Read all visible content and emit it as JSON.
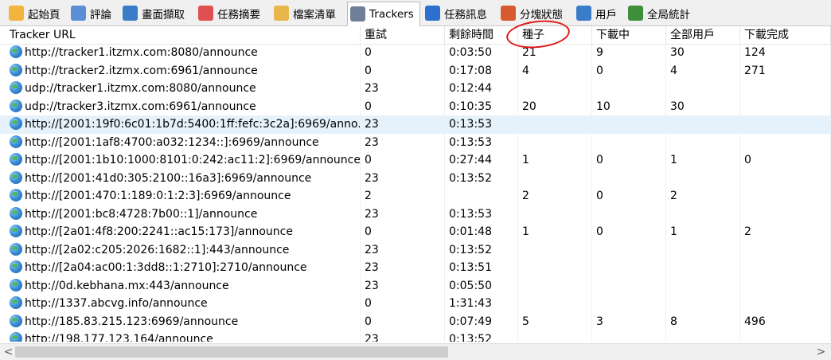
{
  "tabs": [
    {
      "label": "起始頁",
      "icon": "home-icon",
      "color": "#f3b43b"
    },
    {
      "label": "評論",
      "icon": "comment-icon",
      "color": "#5a8fd6"
    },
    {
      "label": "畫面擷取",
      "icon": "screenshot-icon",
      "color": "#3a7cc8"
    },
    {
      "label": "任務摘要",
      "icon": "checklist-icon",
      "color": "#e05050"
    },
    {
      "label": "檔案清單",
      "icon": "file-list-icon",
      "color": "#e8b64a"
    },
    {
      "label": "Trackers",
      "icon": "trackers-icon",
      "color": "#6f7f99"
    },
    {
      "label": "任務訊息",
      "icon": "info-icon",
      "color": "#2d6fcf"
    },
    {
      "label": "分塊狀態",
      "icon": "pie-chart-icon",
      "color": "#d65a2d"
    },
    {
      "label": "用戶",
      "icon": "user-icon",
      "color": "#3a7cc8"
    },
    {
      "label": "全局統計",
      "icon": "stats-icon",
      "color": "#3e8e3e"
    }
  ],
  "columns": {
    "url": "Tracker URL",
    "retry": "重試",
    "time": "剩餘時間",
    "seeds": "種子",
    "downloading": "下載中",
    "users": "全部用戶",
    "completed": "下載完成"
  },
  "rows": [
    {
      "url": "http://tracker1.itzmx.com:8080/announce",
      "retry": "0",
      "time": "0:03:50",
      "seeds": "21",
      "downloading": "9",
      "users": "30",
      "completed": "124"
    },
    {
      "url": "http://tracker2.itzmx.com:6961/announce",
      "retry": "0",
      "time": "0:17:08",
      "seeds": "4",
      "downloading": "0",
      "users": "4",
      "completed": "271"
    },
    {
      "url": "udp://tracker1.itzmx.com:8080/announce",
      "retry": "23",
      "time": "0:12:44",
      "seeds": "",
      "downloading": "",
      "users": "",
      "completed": ""
    },
    {
      "url": "udp://tracker3.itzmx.com:6961/announce",
      "retry": "0",
      "time": "0:10:35",
      "seeds": "20",
      "downloading": "10",
      "users": "30",
      "completed": ""
    },
    {
      "url": "http://[2001:19f0:6c01:1b7d:5400:1ff:fefc:3c2a]:6969/anno...",
      "retry": "23",
      "time": "0:13:53",
      "seeds": "",
      "downloading": "",
      "users": "",
      "completed": ""
    },
    {
      "url": "http://[2001:1af8:4700:a032:1234::]:6969/announce",
      "retry": "23",
      "time": "0:13:53",
      "seeds": "",
      "downloading": "",
      "users": "",
      "completed": ""
    },
    {
      "url": "http://[2001:1b10:1000:8101:0:242:ac11:2]:6969/announce",
      "retry": "0",
      "time": "0:27:44",
      "seeds": "1",
      "downloading": "0",
      "users": "1",
      "completed": "0"
    },
    {
      "url": "http://[2001:41d0:305:2100::16a3]:6969/announce",
      "retry": "23",
      "time": "0:13:52",
      "seeds": "",
      "downloading": "",
      "users": "",
      "completed": ""
    },
    {
      "url": "http://[2001:470:1:189:0:1:2:3]:6969/announce",
      "retry": "2",
      "time": "",
      "seeds": "2",
      "downloading": "0",
      "users": "2",
      "completed": ""
    },
    {
      "url": "http://[2001:bc8:4728:7b00::1]/announce",
      "retry": "23",
      "time": "0:13:53",
      "seeds": "",
      "downloading": "",
      "users": "",
      "completed": ""
    },
    {
      "url": "http://[2a01:4f8:200:2241::ac15:173]/announce",
      "retry": "0",
      "time": "0:01:48",
      "seeds": "1",
      "downloading": "0",
      "users": "1",
      "completed": "2"
    },
    {
      "url": "http://[2a02:c205:2026:1682::1]:443/announce",
      "retry": "23",
      "time": "0:13:52",
      "seeds": "",
      "downloading": "",
      "users": "",
      "completed": ""
    },
    {
      "url": "http://[2a04:ac00:1:3dd8::1:2710]:2710/announce",
      "retry": "23",
      "time": "0:13:51",
      "seeds": "",
      "downloading": "",
      "users": "",
      "completed": ""
    },
    {
      "url": "http://0d.kebhana.mx:443/announce",
      "retry": "23",
      "time": "0:05:50",
      "seeds": "",
      "downloading": "",
      "users": "",
      "completed": ""
    },
    {
      "url": "http://1337.abcvg.info/announce",
      "retry": "0",
      "time": "1:31:43",
      "seeds": "",
      "downloading": "",
      "users": "",
      "completed": ""
    },
    {
      "url": "http://185.83.215.123:6969/announce",
      "retry": "0",
      "time": "0:07:49",
      "seeds": "5",
      "downloading": "3",
      "users": "8",
      "completed": "496"
    },
    {
      "url": "http://198.177.123.164/announce",
      "retry": "23",
      "time": "0:13:52",
      "seeds": "",
      "downloading": "",
      "users": "",
      "completed": ""
    }
  ],
  "selected_row": 4,
  "active_tab": 5,
  "scroll_left_icon": "chevron-left-icon",
  "scroll_right_icon": "chevron-right-icon",
  "scroll_left": "<",
  "scroll_right": ">",
  "annotation_color": "#e01818"
}
